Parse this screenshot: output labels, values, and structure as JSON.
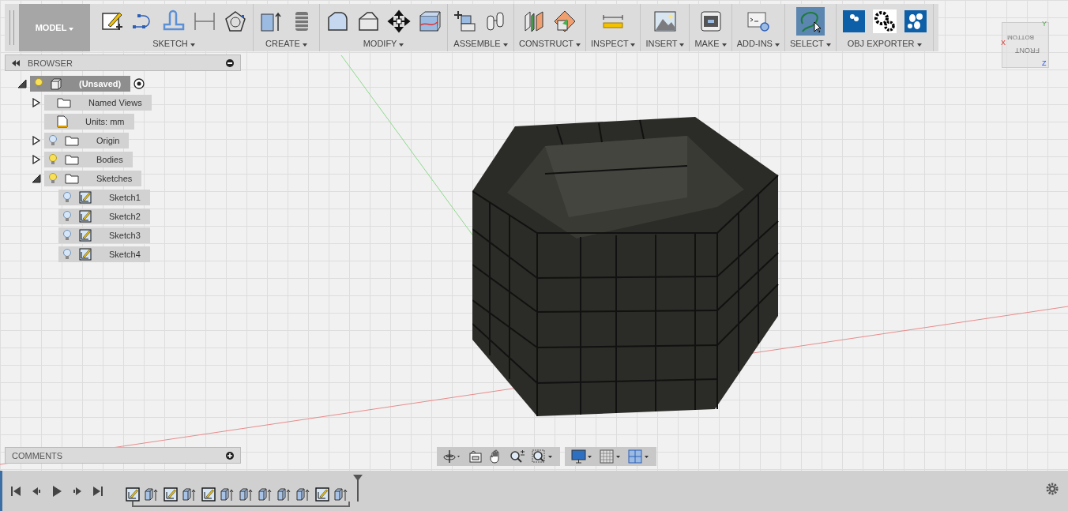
{
  "toolbar": {
    "workspace": "MODEL",
    "groups": [
      {
        "label": "SKETCH",
        "active": false
      },
      {
        "label": "CREATE",
        "active": false
      },
      {
        "label": "MODIFY",
        "active": false
      },
      {
        "label": "ASSEMBLE",
        "active": false
      },
      {
        "label": "CONSTRUCT",
        "active": false
      },
      {
        "label": "INSPECT",
        "active": false
      },
      {
        "label": "INSERT",
        "active": false
      },
      {
        "label": "MAKE",
        "active": false
      },
      {
        "label": "ADD-INS",
        "active": false
      },
      {
        "label": "SELECT",
        "active": true
      },
      {
        "label": "OBJ EXPORTER",
        "active": false
      }
    ]
  },
  "browser": {
    "title": "BROWSER",
    "tree": [
      {
        "label": "(Unsaved)",
        "kind": "component",
        "selected": true,
        "visible": true,
        "expanded": true,
        "children": [
          {
            "label": "Named Views",
            "kind": "folder",
            "selected": false,
            "expanded": false
          },
          {
            "label": "Units: mm",
            "kind": "units",
            "selected": false
          },
          {
            "label": "Origin",
            "kind": "folder",
            "selected": false,
            "visible": false,
            "expanded": false
          },
          {
            "label": "Bodies",
            "kind": "folder",
            "selected": false,
            "visible": true,
            "expanded": false
          },
          {
            "label": "Sketches",
            "kind": "folder",
            "selected": false,
            "visible": true,
            "expanded": true,
            "children": [
              {
                "label": "Sketch1",
                "kind": "sketch",
                "selected": false,
                "visible": false
              },
              {
                "label": "Sketch2",
                "kind": "sketch",
                "selected": false,
                "visible": false
              },
              {
                "label": "Sketch3",
                "kind": "sketch",
                "selected": false,
                "visible": false
              },
              {
                "label": "Sketch4",
                "kind": "sketch",
                "selected": false,
                "visible": false
              }
            ]
          }
        ]
      }
    ]
  },
  "comments": {
    "title": "COMMENTS"
  },
  "view_cube": {
    "faces": [
      "FRONT",
      "BOTTOM"
    ],
    "axes": [
      "X",
      "Y",
      "Z"
    ]
  },
  "timeline": {
    "features": [
      {
        "kind": "sketch"
      },
      {
        "kind": "extrude"
      },
      {
        "kind": "sketch"
      },
      {
        "kind": "extrude"
      },
      {
        "kind": "sketch"
      },
      {
        "kind": "extrude"
      },
      {
        "kind": "extrude"
      },
      {
        "kind": "extrude"
      },
      {
        "kind": "extrude"
      },
      {
        "kind": "extrude"
      },
      {
        "kind": "sketch"
      },
      {
        "kind": "extrude"
      }
    ]
  }
}
